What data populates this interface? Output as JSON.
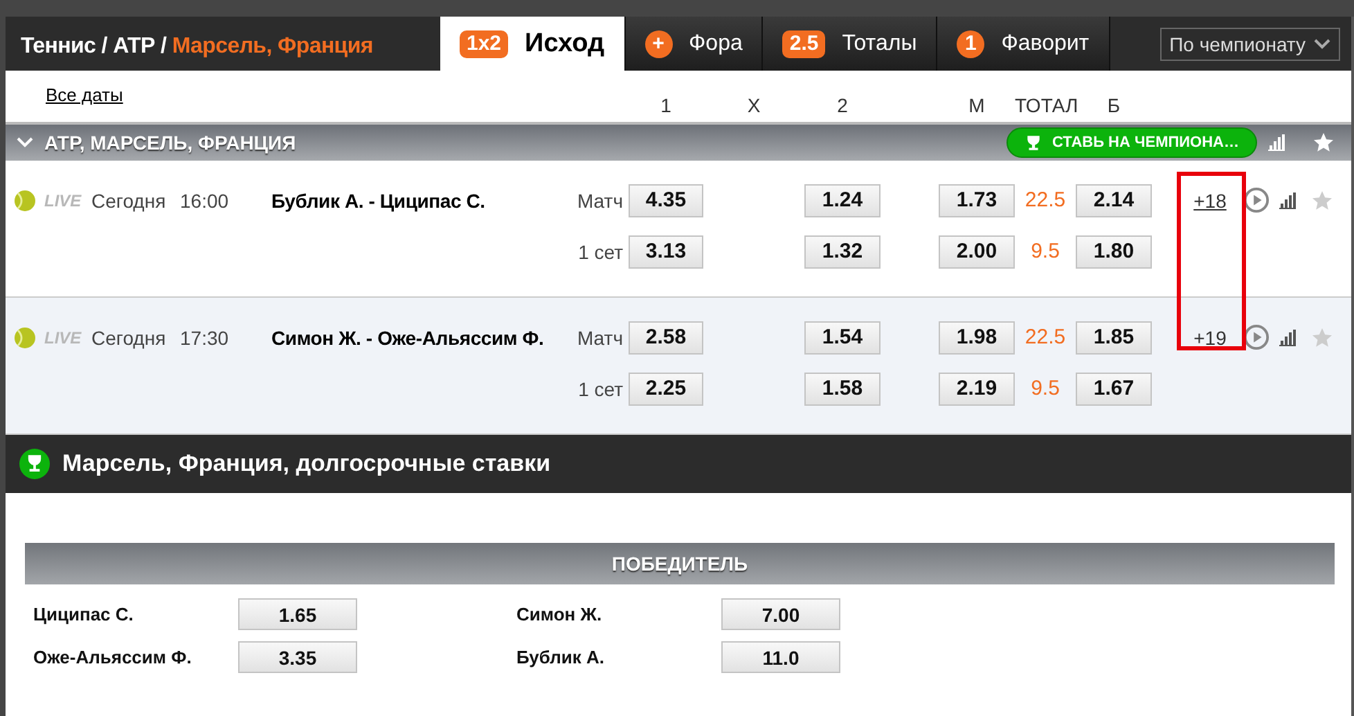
{
  "breadcrumb": {
    "path": "Теннис / АТР /",
    "current": "Марсель, Франция"
  },
  "tabs": [
    {
      "badge": "1x2",
      "label": "Исход",
      "selected": true
    },
    {
      "badge": "+",
      "label": "Фора",
      "selected": false
    },
    {
      "badge": "2.5",
      "label": "Тоталы",
      "selected": false
    },
    {
      "badge": "1",
      "label": "Фаворит",
      "selected": false
    }
  ],
  "market_select": {
    "value": "По чемпионату"
  },
  "columns_header": {
    "dates_link": "Все даты",
    "columns": [
      "1",
      "X",
      "2",
      "М",
      "ТОТАЛ",
      "Б"
    ]
  },
  "section": {
    "title": "АТР, МАРСЕЛЬ, ФРАНЦИЯ",
    "expanded": true,
    "promo_button": "СТАВЬ НА ЧЕМПИОНА…"
  },
  "events": [
    {
      "live": "LIVE",
      "date": "Сегодня",
      "time": "16:00",
      "players": "Бублик А. - Циципас С.",
      "more": "+18",
      "markets": [
        {
          "label": "Матч",
          "odds_1": "4.35",
          "odds_2": "1.24",
          "under": "1.73",
          "total": "22.5",
          "over": "2.14"
        },
        {
          "label": "1 сет",
          "odds_1": "3.13",
          "odds_2": "1.32",
          "under": "2.00",
          "total": "9.5",
          "over": "1.80"
        }
      ]
    },
    {
      "live": "LIVE",
      "date": "Сегодня",
      "time": "17:30",
      "players": "Симон Ж. - Оже-Альяссим Ф.",
      "more": "+19",
      "markets": [
        {
          "label": "Матч",
          "odds_1": "2.58",
          "odds_2": "1.54",
          "under": "1.98",
          "total": "22.5",
          "over": "1.85"
        },
        {
          "label": "1 сет",
          "odds_1": "2.25",
          "odds_2": "1.58",
          "under": "2.19",
          "total": "9.5",
          "over": "1.67"
        }
      ]
    }
  ],
  "more_highlighted": true,
  "longterm": {
    "title": "Марсель, Франция, долгосрочные ставки",
    "market": "ПОБЕДИТЕЛЬ",
    "outcomes": [
      {
        "name": "Циципас С.",
        "odds": "1.65"
      },
      {
        "name": "Симон Ж.",
        "odds": "7.00"
      },
      {
        "name": "Оже-Альяссим Ф.",
        "odds": "3.35"
      },
      {
        "name": "Бублик А.",
        "odds": "11.0"
      }
    ]
  }
}
